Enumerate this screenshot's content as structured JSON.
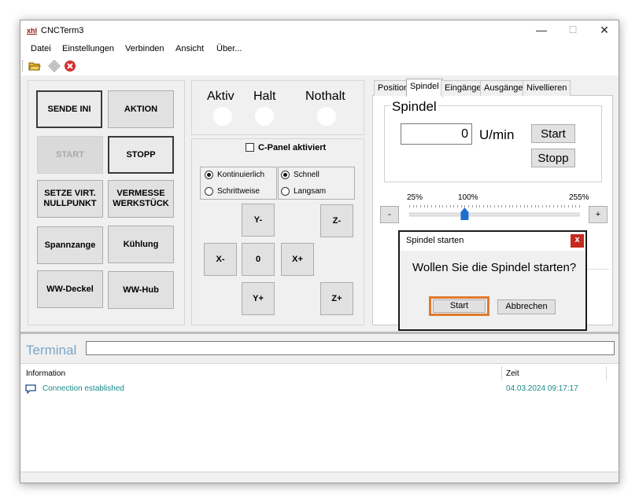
{
  "window": {
    "title": "CNCTerm3",
    "logo": "xhl"
  },
  "window_controls": {
    "minimize": "—",
    "maximize": "☐",
    "close": "✕"
  },
  "menu": [
    "Datei",
    "Einstellungen",
    "Verbinden",
    "Ansicht",
    "Über..."
  ],
  "toolbar": {
    "icons": [
      "open-folder-icon",
      "diamond-icon",
      "stop-circle-icon"
    ],
    "accent": "#d32f2f"
  },
  "left_buttons": {
    "sende_ini": "SENDE INI",
    "aktion": "AKTION",
    "start": "START",
    "stopp": "STOPP",
    "setze_1": "SETZE VIRT.",
    "setze_2": "NULLPUNKT",
    "vermesse_1": "VERMESSE",
    "vermesse_2": "WERKSTÜCK",
    "spannzange": "Spannzange",
    "kuehlung": "Kühlung",
    "ww_deckel": "WW-Deckel",
    "ww_hub": "WW-Hub"
  },
  "status_leds": {
    "aktiv": "Aktiv",
    "halt": "Halt",
    "nothalt": "Nothalt"
  },
  "cpanel": {
    "label": "C-Panel aktiviert",
    "checked": false
  },
  "jog_mode": {
    "kontinuierlich": "Kontinuierlich",
    "schrittweise": "Schrittweise",
    "schnell": "Schnell",
    "langsam": "Langsam"
  },
  "jog_buttons": {
    "y_minus": "Y-",
    "z_minus": "Z-",
    "x_minus": "X-",
    "zero": "0",
    "x_plus": "X+",
    "y_plus": "Y+",
    "z_plus": "Z+"
  },
  "tabs": [
    "Position",
    "Spindel",
    "Eingänge",
    "Ausgänge",
    "Nivellieren"
  ],
  "active_tab": "Spindel",
  "spindel": {
    "group_title": "Spindel",
    "rpm_value": "0",
    "unit": "U/min",
    "start": "Start",
    "stopp": "Stopp",
    "override_min": "25%",
    "override_mid": "100%",
    "override_max": "255%",
    "override_current": 100,
    "minus": "-",
    "plus": "+"
  },
  "dialog": {
    "title": "Spindel starten",
    "close": "x",
    "message": "Wollen Sie die Spindel starten?",
    "ok": "Start",
    "cancel": "Abbrechen",
    "highlight": "#e07a2b"
  },
  "terminal": {
    "label": "Terminal",
    "input_value": "",
    "columns": {
      "info": "Information",
      "time": "Zeit"
    },
    "rows": [
      {
        "info": "Connection established",
        "time": "04.03.2024 09:17:17"
      }
    ],
    "row_color": "#1a8a8a"
  }
}
